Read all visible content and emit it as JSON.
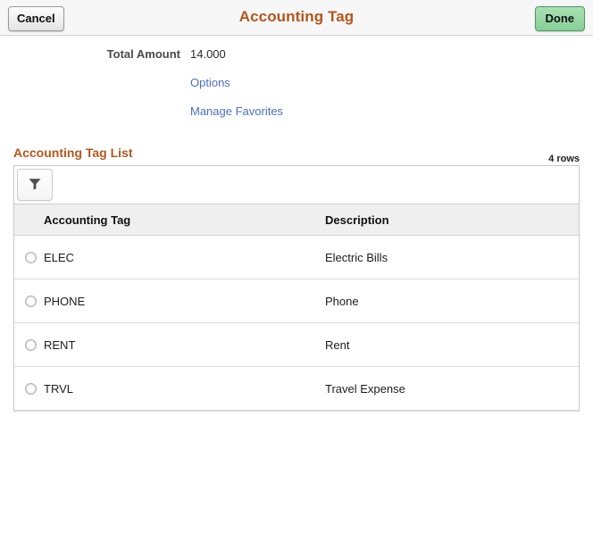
{
  "header": {
    "title": "Accounting Tag",
    "cancel_label": "Cancel",
    "done_label": "Done"
  },
  "form": {
    "total_amount_label": "Total Amount",
    "total_amount_value": "14.000",
    "options_link": "Options",
    "manage_favorites_link": "Manage Favorites"
  },
  "grid": {
    "title": "Accounting Tag List",
    "row_count_label": "4 rows",
    "filter_icon": "filter-funnel-icon",
    "columns": {
      "tag": "Accounting Tag",
      "description": "Description"
    },
    "rows": [
      {
        "tag": "ELEC",
        "description": "Electric Bills"
      },
      {
        "tag": "PHONE",
        "description": "Phone"
      },
      {
        "tag": "RENT",
        "description": "Rent"
      },
      {
        "tag": "TRVL",
        "description": "Travel Expense"
      }
    ]
  },
  "colors": {
    "title_orange": "#b4561c",
    "link_blue": "#4d6fc4",
    "done_green": "#87cf97",
    "header_bg": "#f7f7f7",
    "col_header_bg": "#efefef"
  }
}
